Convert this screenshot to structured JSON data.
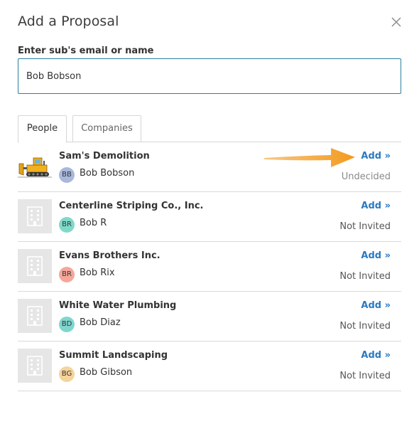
{
  "dialog": {
    "title": "Add a Proposal",
    "close_icon": "close-icon"
  },
  "search": {
    "label": "Enter sub's email or name",
    "value": "Bob Bobson"
  },
  "tabs": [
    {
      "label": "People",
      "active": true
    },
    {
      "label": "Companies",
      "active": false
    }
  ],
  "results": [
    {
      "company": "Sam's Demolition",
      "contact": "Bob Bobson",
      "initials": "BB",
      "avatar_color": "#a9b8dc",
      "action": "Add »",
      "status": "Undecided",
      "logo": "bulldozer-logo"
    },
    {
      "company": "Centerline Striping Co., Inc.",
      "contact": "Bob R",
      "initials": "BR",
      "avatar_color": "#7fd9c8",
      "action": "Add »",
      "status": "Not Invited",
      "logo": "building-icon"
    },
    {
      "company": "Evans Brothers Inc.",
      "contact": "Bob Rix",
      "initials": "BR",
      "avatar_color": "#f4a79a",
      "action": "Add »",
      "status": "Not Invited",
      "logo": "building-icon"
    },
    {
      "company": "White Water Plumbing",
      "contact": "Bob Diaz",
      "initials": "BD",
      "avatar_color": "#7fd6cf",
      "action": "Add »",
      "status": "Not Invited",
      "logo": "building-icon"
    },
    {
      "company": "Summit Landscaping",
      "contact": "Bob Gibson",
      "initials": "BG",
      "avatar_color": "#f6d39b",
      "action": "Add »",
      "status": "Not Invited",
      "logo": "building-icon"
    }
  ],
  "colors": {
    "link": "#2b79c2",
    "input_border": "#2a7f9e",
    "arrow": "#f39a1e"
  }
}
